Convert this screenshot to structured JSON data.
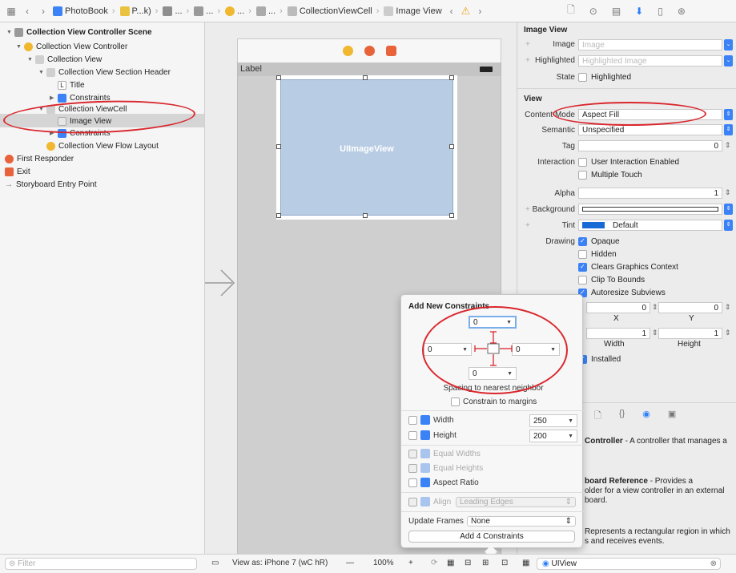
{
  "jumpbar": {
    "crumbs": [
      "PhotoBook",
      "P...k)",
      "...",
      "...",
      "...",
      "...",
      "CollectionViewCell",
      "Image View"
    ]
  },
  "outline": {
    "items": [
      "Collection View Controller Scene",
      "Collection View Controller",
      "Collection View",
      "Collection View Section Header",
      "Title",
      "Constraints",
      "Collection ViewCell",
      "Image View",
      "Constraints",
      "Collection View Flow Layout",
      "First Responder",
      "Exit",
      "Storyboard Entry Point"
    ],
    "title_badge": "L"
  },
  "canvas": {
    "header_label": "Label",
    "image_view_label": "UIImageView"
  },
  "inspector": {
    "image_view_title": "Image View",
    "image_label": "Image",
    "image_placeholder": "Image",
    "highlighted_label": "Highlighted",
    "highlighted_placeholder": "Highlighted Image",
    "state_label": "State",
    "state_value": "Highlighted",
    "view_title": "View",
    "content_mode_label": "Content Mode",
    "content_mode_value": "Aspect Fill",
    "semantic_label": "Semantic",
    "semantic_value": "Unspecified",
    "tag_label": "Tag",
    "tag_value": "0",
    "interaction_label": "Interaction",
    "user_interaction": "User Interaction Enabled",
    "multiple_touch": "Multiple Touch",
    "alpha_label": "Alpha",
    "alpha_value": "1",
    "background_label": "Background",
    "tint_label": "Tint",
    "tint_value": "Default",
    "drawing_label": "Drawing",
    "opaque": "Opaque",
    "hidden": "Hidden",
    "clears": "Clears Graphics Context",
    "clip": "Clip To Bounds",
    "autoresize": "Autoresize Subviews",
    "x_value": "0",
    "y_value": "0",
    "x_label": "X",
    "y_label": "Y",
    "width_value": "1",
    "height_value": "1",
    "width_label": "Width",
    "height_label": "Height",
    "installed": "Installed",
    "lib_controller_title": "Controller",
    "lib_controller_desc": "- A controller that manages a",
    "lib_board_title": "board Reference",
    "lib_board_desc": "- Provides a",
    "lib_board_desc2": "older for a view controller in an external",
    "lib_board_desc3": "board.",
    "lib_view_desc": "Represents a rectangular region in which",
    "lib_view_desc2": "s and receives events."
  },
  "popover": {
    "title": "Add New Constraints",
    "top": "0",
    "left": "0",
    "right": "0",
    "bottom": "0",
    "spacing_text": "Spacing to nearest neighbor",
    "constrain_margins": "Constrain to margins",
    "width_label": "Width",
    "width_value": "250",
    "height_label": "Height",
    "height_value": "200",
    "equal_widths": "Equal Widths",
    "equal_heights": "Equal Heights",
    "aspect_ratio": "Aspect Ratio",
    "align_label": "Align",
    "align_value": "Leading Edges",
    "update_frames_label": "Update Frames",
    "update_frames_value": "None",
    "add_button": "Add 4 Constraints"
  },
  "bottombar": {
    "filter_placeholder": "Filter",
    "view_as": "View as: iPhone 7 (wC hR)",
    "minus": "—",
    "zoom": "100%",
    "plus": "+",
    "insp_filter": "UIView"
  },
  "colors": {
    "accent": "#3b82f6",
    "annotation": "#d9262c",
    "image_view_fill": "#b8cce4"
  }
}
